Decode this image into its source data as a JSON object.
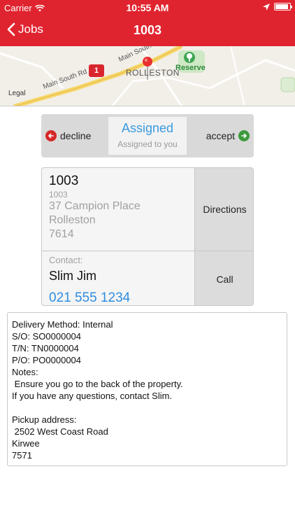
{
  "status_bar": {
    "carrier": "Carrier",
    "time": "10:55 AM",
    "battery_level": 0.9
  },
  "nav": {
    "back_label": "Jobs",
    "title": "1003"
  },
  "map": {
    "road_main_south": "Main South",
    "road_main_south_rd": "Main South Rd",
    "highway_number": "1",
    "town": "ROLLESTON",
    "reserve": "Reserve",
    "legal": "Legal"
  },
  "segment": {
    "decline_label": "decline",
    "status_label": "Assigned",
    "status_sub": "Assigned to you",
    "accept_label": "accept"
  },
  "job": {
    "number": "1003",
    "number_sub": "1003",
    "address_line1": "37 Campion Place",
    "address_line2": "Rolleston",
    "postcode": "7614",
    "directions_label": "Directions",
    "contact_label": "Contact:",
    "contact_name": "Slim Jim",
    "contact_phone": "021 555 1234",
    "call_label": "Call"
  },
  "notes": {
    "text": "Delivery Method: Internal\nS/O: SO0000004\nT/N: TN0000004\nP/O: PO0000004\nNotes:\n Ensure you go to the back of the property.\nIf you have any questions, contact Slim.\n\nPickup address:\n 2502 West Coast Road\nKirwee\n7571"
  },
  "colors": {
    "brand_red": "#e0242f",
    "accent_blue": "#3a9be0",
    "decline_red": "#d62828",
    "accept_green": "#3c9a3c"
  }
}
